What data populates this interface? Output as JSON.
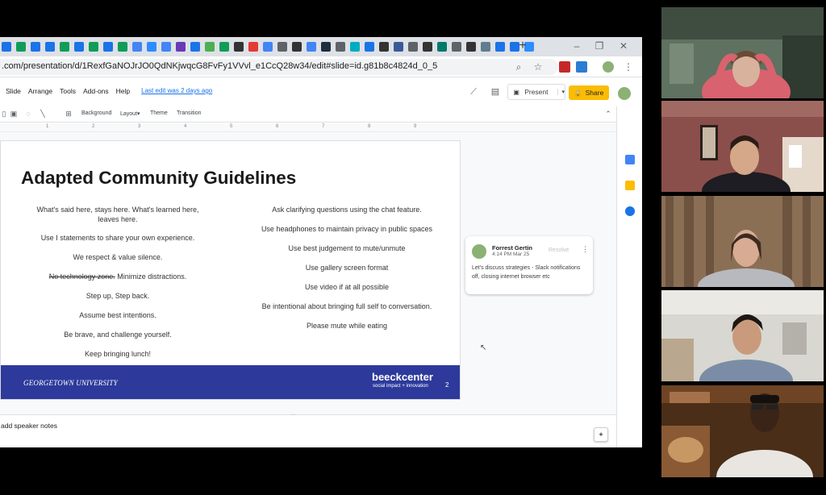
{
  "browser": {
    "url": ".com/presentation/d/1RexfGaNOJrJO0QdNKjwqcG8FvFy1VVvl_e1CcQ28w34/edit#slide=id.g81b8c4824d_0_5",
    "new_tab": "+",
    "tab_icons": [
      "#1a73e8",
      "#0f9d58",
      "#1a73e8",
      "#1a73e8",
      "#0f9d58",
      "#1a73e8",
      "#0f9d58",
      "#1a73e8",
      "#0f9d58",
      "#4285f4",
      "#2d8cff",
      "#4285f4",
      "#673ab7",
      "#1a73e8",
      "#4caf50",
      "#0f9d58",
      "#333333",
      "#e53935",
      "#4285f4",
      "#5f6368",
      "#333333",
      "#4285f4",
      "#1f2d3d",
      "#5f6368",
      "#00acc1",
      "#1a73e8",
      "#333333",
      "#3b5998",
      "#5f6368",
      "#333333",
      "#00796b",
      "#5f6368",
      "#333333",
      "#607d8b",
      "#1a73e8",
      "#1a73e8",
      "#2d8cff"
    ]
  },
  "docs": {
    "menus": [
      "Slide",
      "Arrange",
      "Tools",
      "Add-ons",
      "Help"
    ],
    "last_edit": "Last edit was 2 days ago",
    "present_label": "Present",
    "share_label": "Share"
  },
  "toolbar": {
    "background_label": "Background",
    "layout_label": "Layout",
    "theme_label": "Theme",
    "transition_label": "Transition"
  },
  "ruler": {
    "ticks": [
      "1",
      "2",
      "3",
      "4",
      "5",
      "6",
      "7",
      "8",
      "9"
    ]
  },
  "slide": {
    "title": "Adapted Community Guidelines",
    "left_rules": [
      "What's said here, stays here. What's learned here, leaves here.",
      "Use I statements to share your own experience.",
      "We respect & value silence.",
      "Step up, Step back.",
      "Assume best intentions.",
      "Be brave, and challenge yourself.",
      "Keep bringing lunch!"
    ],
    "struck_text": "No technology zone.",
    "struck_suffix": " Minimize distractions.",
    "right_rules": [
      "Ask clarifying questions using the chat feature.",
      "Use headphones to maintain privacy in public spaces",
      "Use best judgement to mute/unmute",
      "Use gallery screen format",
      "Use video if at all possible",
      "Be intentional about bringing full self to conversation.",
      "Please mute while eating"
    ],
    "footer_university": "GEORGETOWN UNIVERSITY",
    "footer_brand": "beeckcenter",
    "footer_tagline": "social impact + innovation",
    "page_number": "2",
    "footer_color": "#2d3a9b"
  },
  "comment": {
    "author": "Forrest Gertin",
    "time": "4:14 PM Mar 25",
    "resolve": "Resolve",
    "text": "Let's discuss strategies - Slack notifications off, closing internet browser etc"
  },
  "notes": {
    "placeholder": "add speaker notes"
  }
}
